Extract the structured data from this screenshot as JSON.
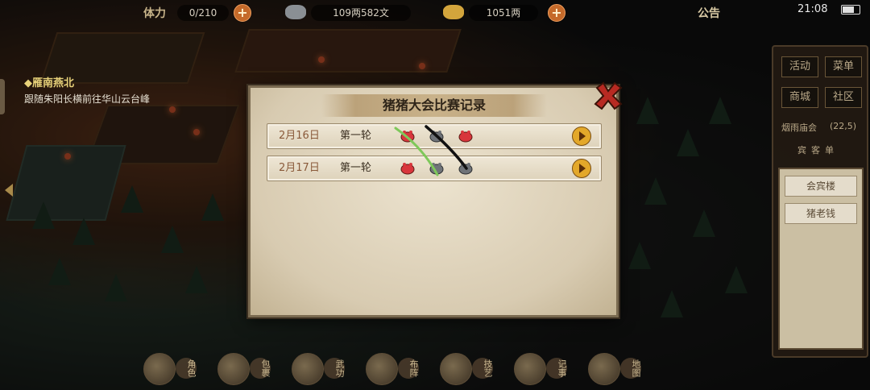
{
  "topbar": {
    "stamina_label": "体力",
    "stamina_value": "0/210",
    "money_value": "109两582文",
    "gold_value": "1051两",
    "notice_label": "公告",
    "time": "21:08"
  },
  "quest": {
    "title": "◆雁南燕北",
    "text": "跟随朱阳长横前往华山云台峰"
  },
  "right_panel": {
    "activity": "活动",
    "menu": "菜单",
    "shop": "商城",
    "community": "社区",
    "event_label": "烟雨庙会",
    "event_count": "(22,5)",
    "list_header": "宾客单",
    "items": [
      "会宾楼",
      "猪老钱"
    ]
  },
  "bottom_menu": [
    "角色",
    "包裹",
    "武功",
    "布阵",
    "技艺",
    "记事",
    "地图"
  ],
  "dialog": {
    "title": "猪猪大会比赛记录",
    "rows": [
      {
        "date": "2月16日",
        "round": "第一轮",
        "pigs": [
          "red",
          "gray",
          "red"
        ]
      },
      {
        "date": "2月17日",
        "round": "第一轮",
        "pigs": [
          "red",
          "gray",
          "gray"
        ]
      }
    ]
  },
  "colors": {
    "scribble_green": "#7ec85a",
    "scribble_black": "#111111",
    "pig_red": "#d8363c",
    "pig_gray": "#6f7378",
    "play_button": "#e3a82a"
  }
}
